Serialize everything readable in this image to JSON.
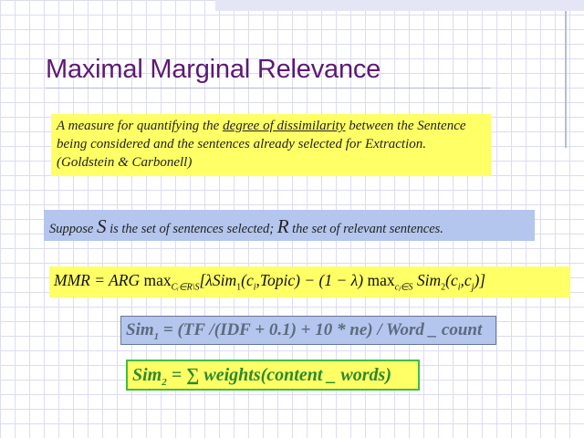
{
  "slide": {
    "title": "Maximal Marginal Relevance",
    "definition": {
      "part1": "A measure for quantifying the ",
      "underlined": "degree of dissimilarity",
      "part2": " between the Sentence being considered and the sentences already selected  for Extraction. (Goldstein & Carbonell)"
    },
    "supposition": {
      "t1": "Suppose ",
      "s": "S",
      "t2": " is the set of sentences selected; ",
      "r": "R",
      "t3": " the set of relevant sentences."
    },
    "formula_main": {
      "a": "MMR = ARG ",
      "max1": "max",
      "sub1": "Cᵢ∈R\\S",
      "b": "[λSim",
      "sub_b": "1",
      "c": "(c",
      "sub_c": "i",
      "d": ",Topic) − (1 − λ) ",
      "max2": "max",
      "sub2": "cⱼ∈S",
      "e": " Sim",
      "sub_e": "2",
      "f": "(c",
      "sub_f": "i",
      "g": ",c",
      "sub_g": "j",
      "h": ")]"
    },
    "formula_sim1": {
      "a": "Sim",
      "sub": "1",
      "b": " = (TF /(IDF + 0.1) + 10 * ne) / Word _ count"
    },
    "formula_sim2": {
      "a": "Sim",
      "sub": "2",
      "b": " = ∑ weights(content _ words)"
    }
  },
  "colors": {
    "title": "#5c1a74",
    "yellow_box": "#ffff66",
    "blue_box": "#b4c6ee",
    "sim2_border": "#44bb44",
    "sim2_text": "#2c8a2c"
  }
}
